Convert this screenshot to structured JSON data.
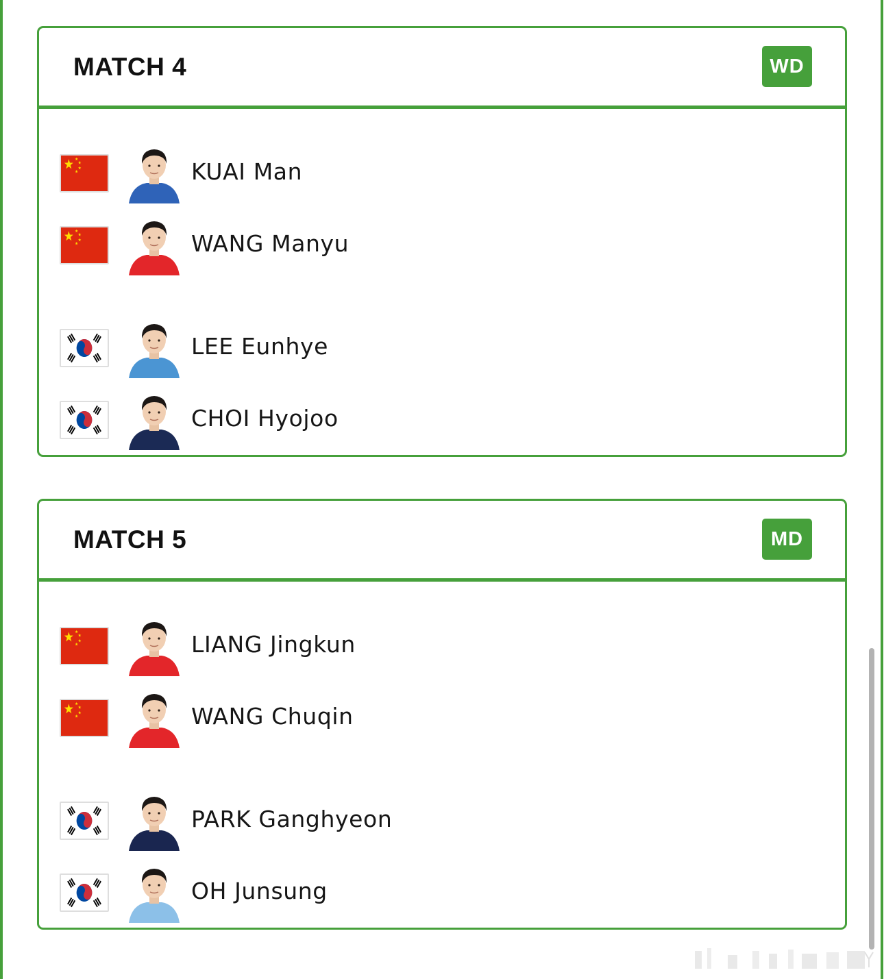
{
  "matches": [
    {
      "title": "MATCH 4",
      "event": "WD",
      "players": [
        {
          "name": "KUAI Man",
          "flag": "china-flag",
          "jersey": "#2f63b8"
        },
        {
          "name": "WANG Manyu",
          "flag": "china-flag",
          "jersey": "#e3262a"
        },
        {
          "name": "LEE Eunhye",
          "flag": "korea-flag",
          "jersey": "#4b95d3"
        },
        {
          "name": "CHOI Hyojoo",
          "flag": "korea-flag",
          "jersey": "#1b2a55"
        }
      ]
    },
    {
      "title": "MATCH 5",
      "event": "MD",
      "players": [
        {
          "name": "LIANG Jingkun",
          "flag": "china-flag",
          "jersey": "#e3262a"
        },
        {
          "name": "WANG Chuqin",
          "flag": "china-flag",
          "jersey": "#e3262a"
        },
        {
          "name": "PARK Ganghyeon",
          "flag": "korea-flag",
          "jersey": "#1a2650"
        },
        {
          "name": "OH Junsung",
          "flag": "korea-flag",
          "jersey": "#8cc0e8"
        }
      ]
    }
  ],
  "colors": {
    "accent": "#46a03b",
    "china_red": "#de2910",
    "china_star": "#ffde00",
    "korea_red": "#cd2e3a",
    "korea_blue": "#0047a0"
  }
}
